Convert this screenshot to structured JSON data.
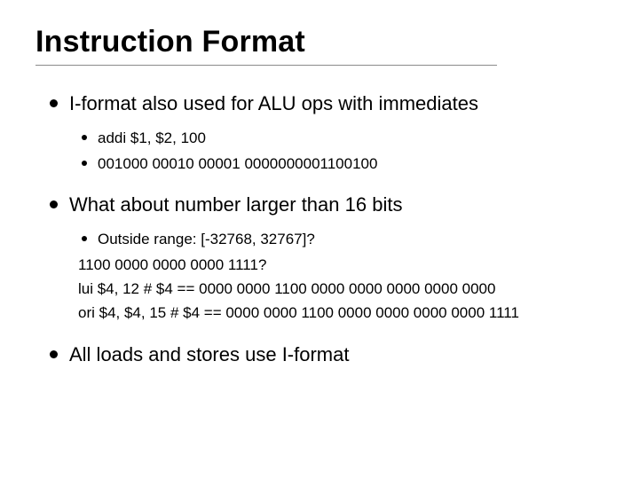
{
  "title": "Instruction Format",
  "bullets": {
    "b1": {
      "text": "I-format also used for ALU ops with immediates",
      "sub": {
        "s1": "addi $1, $2, 100",
        "s2": "001000 00010 00001 0000000001100100"
      }
    },
    "b2": {
      "text": "What about number larger than 16 bits",
      "sub": {
        "s1": "Outside range: [-32768, 32767]?"
      },
      "lines": {
        "l1": "1100 0000 0000 0000 1111?",
        "l2": "lui $4, 12 # $4 == 0000 0000 1100 0000 0000 0000 0000 0000",
        "l3": "ori $4, $4, 15 # $4 == 0000 0000 1100 0000 0000 0000 0000 1111"
      }
    },
    "b3": {
      "text": "All loads and stores use I-format"
    }
  }
}
